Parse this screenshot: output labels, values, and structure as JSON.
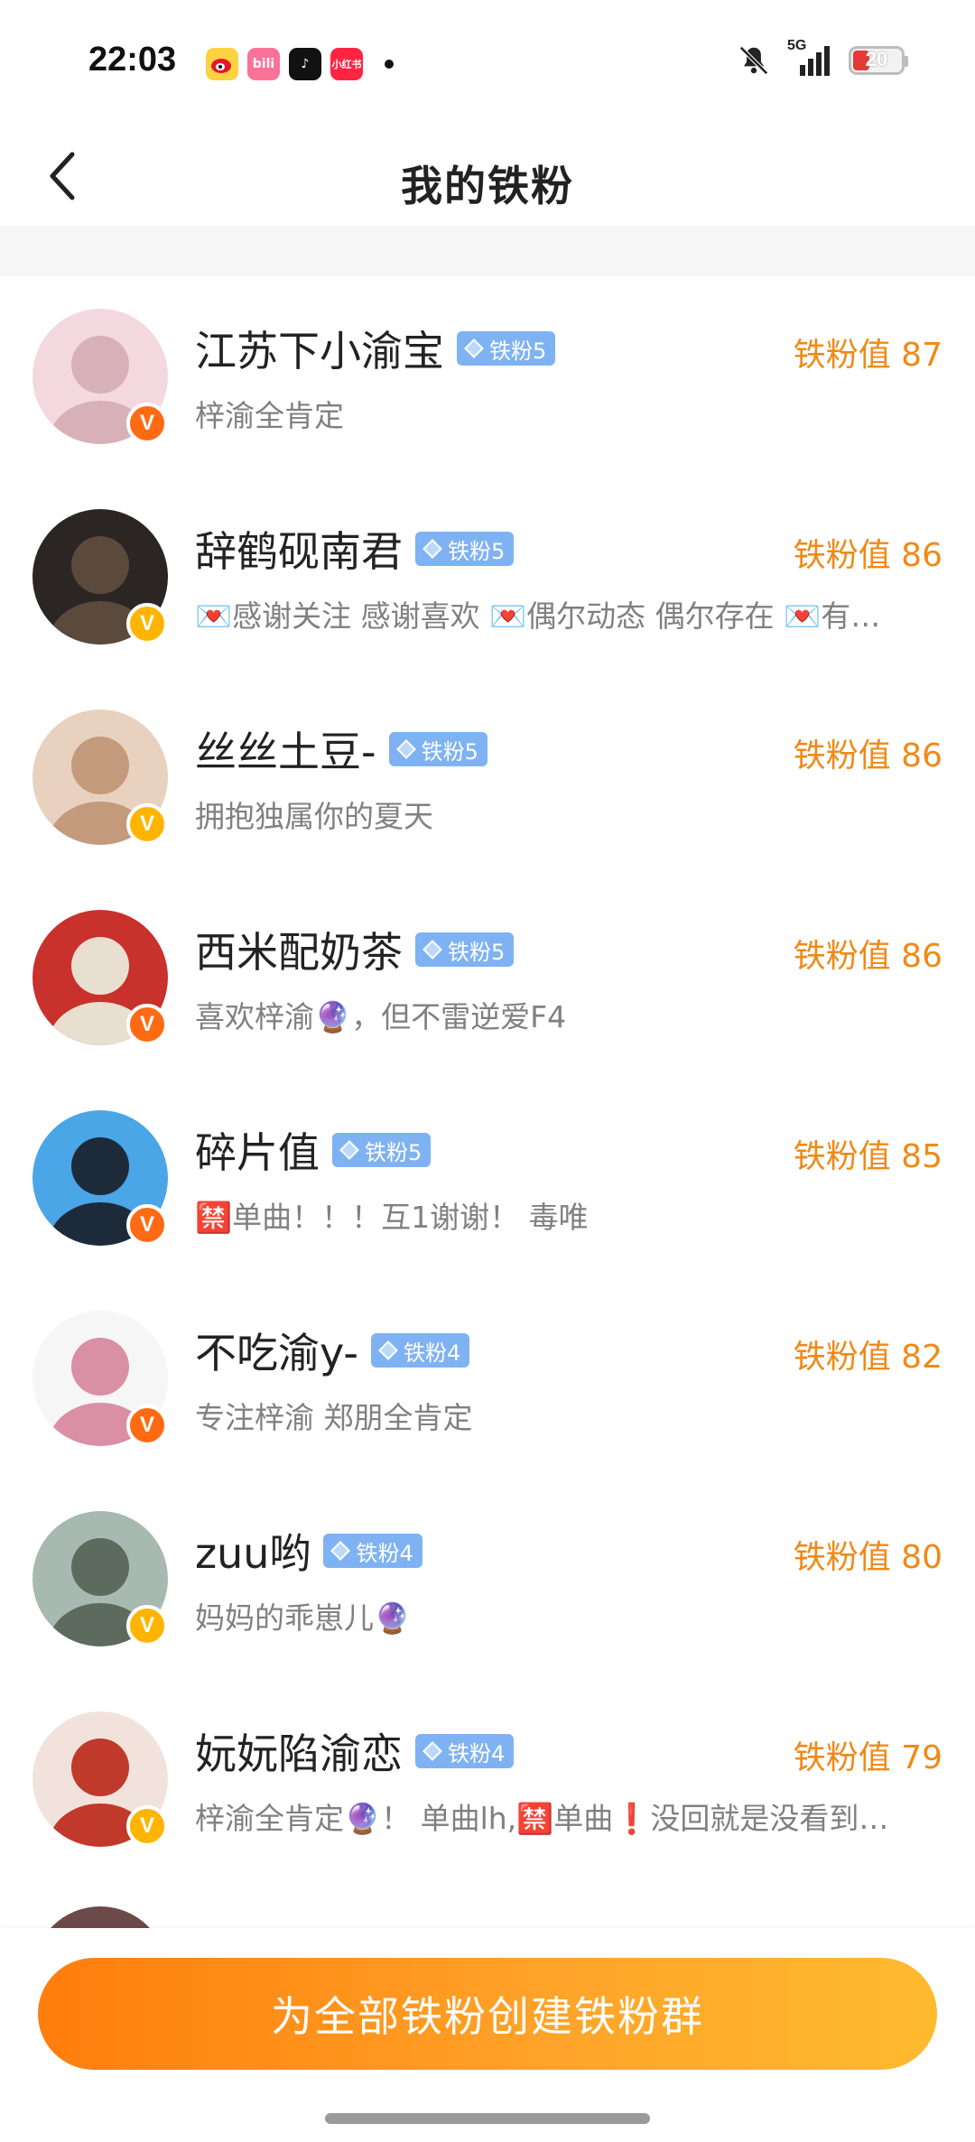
{
  "status_bar": {
    "time": "22:03",
    "app_icons": [
      {
        "name": "weibo-icon",
        "label": "微"
      },
      {
        "name": "bilibili-icon",
        "label": "bili"
      },
      {
        "name": "tiktok-icon",
        "label": "♪"
      },
      {
        "name": "xiaohongshu-icon",
        "label": "小红书"
      }
    ],
    "network": "5G",
    "battery": "20",
    "battery_color": "#e53935"
  },
  "header": {
    "title": "我的铁粉",
    "back_icon": "chevron-left-icon"
  },
  "fans": [
    {
      "name": "江苏下小渝宝",
      "tag": "铁粉5",
      "score": "铁粉值 87",
      "desc": "梓渝全肯定",
      "badge": "orange",
      "avatar_colors": [
        "#f4d8df",
        "#d7b0b8"
      ]
    },
    {
      "name": "辞鹤砚南君",
      "tag": "铁粉5",
      "score": "铁粉值 86",
      "desc": "💌感谢关注 感谢喜欢 💌偶尔动态 偶尔存在 💌有…",
      "badge": "gold",
      "avatar_colors": [
        "#2b2623",
        "#5b4a3c"
      ]
    },
    {
      "name": "丝丝土豆-",
      "tag": "铁粉5",
      "score": "铁粉值 86",
      "desc": "拥抱独属你的夏天",
      "badge": "gold",
      "avatar_colors": [
        "#e8d2bf",
        "#c49a7d"
      ]
    },
    {
      "name": "西米配奶茶",
      "tag": "铁粉5",
      "score": "铁粉值 86",
      "desc": "喜欢梓渝🔮，但不雷逆爱F4",
      "badge": "orange",
      "avatar_colors": [
        "#c9312c",
        "#e9dfd0"
      ]
    },
    {
      "name": "碎片值",
      "tag": "铁粉5",
      "score": "铁粉值 85",
      "desc": "🈲单曲！！！互1谢谢！ 毒唯",
      "badge": "orange",
      "avatar_colors": [
        "#4aa6e6",
        "#1d2a3a"
      ]
    },
    {
      "name": "不吃渝y-",
      "tag": "铁粉4",
      "score": "铁粉值 82",
      "desc": "专注梓渝 郑朋全肯定",
      "badge": "orange",
      "avatar_colors": [
        "#f6f6f6",
        "#d98fa6"
      ]
    },
    {
      "name": "zuu哟",
      "tag": "铁粉4",
      "score": "铁粉值 80",
      "desc": "妈妈的乖崽儿🔮",
      "badge": "gold",
      "avatar_colors": [
        "#a7b9b0",
        "#5d6b5f"
      ]
    },
    {
      "name": "妧妧陷渝恋",
      "tag": "铁粉4",
      "score": "铁粉值 79",
      "desc": "梓渝全肯定🔮！ 单曲lh,🈲单曲❗️没回就是没看到…",
      "badge": "gold",
      "avatar_colors": [
        "#f1e3dc",
        "#c0392b"
      ]
    }
  ],
  "bottom": {
    "button_label": "为全部铁粉创建铁粉群"
  }
}
